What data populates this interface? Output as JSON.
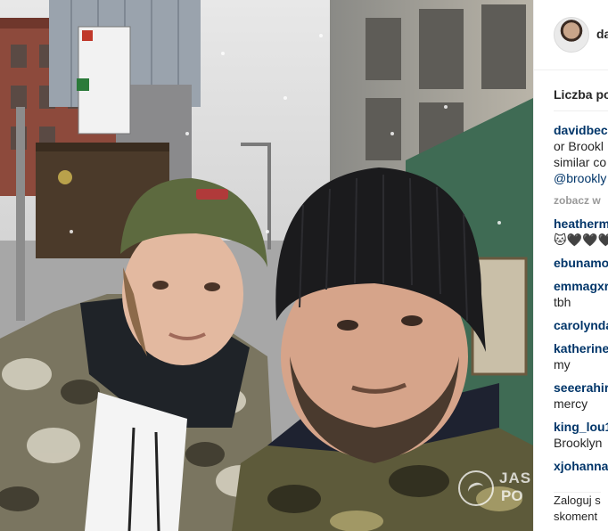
{
  "post": {
    "username": "da",
    "likes_label": "Liczba pol",
    "caption": {
      "user": "davidbec",
      "lines": [
        "or Brookl",
        "similar co"
      ],
      "mention": "@brookly"
    },
    "more_label": "zobacz w",
    "comments": [
      {
        "user": "heatherm",
        "text": "🐱🖤🖤🖤"
      },
      {
        "user": "ebunamo",
        "text": ""
      },
      {
        "user": "emmagxr",
        "text": "tbh"
      },
      {
        "user": "carolynda",
        "text": ""
      },
      {
        "user": "katherine",
        "text": "my"
      },
      {
        "user": "seeerahir",
        "text": "mercy"
      },
      {
        "user": "king_lou1",
        "text": "Brooklyn"
      },
      {
        "user": "xjohanna",
        "text": ""
      }
    ],
    "login": {
      "line1": "Zaloguj s",
      "line2": "skoment"
    }
  },
  "watermark": {
    "text1": "JAS",
    "text2": "PO"
  },
  "colors": {
    "link": "#003569",
    "text": "#262626",
    "muted": "#999999",
    "border": "#efefef"
  }
}
